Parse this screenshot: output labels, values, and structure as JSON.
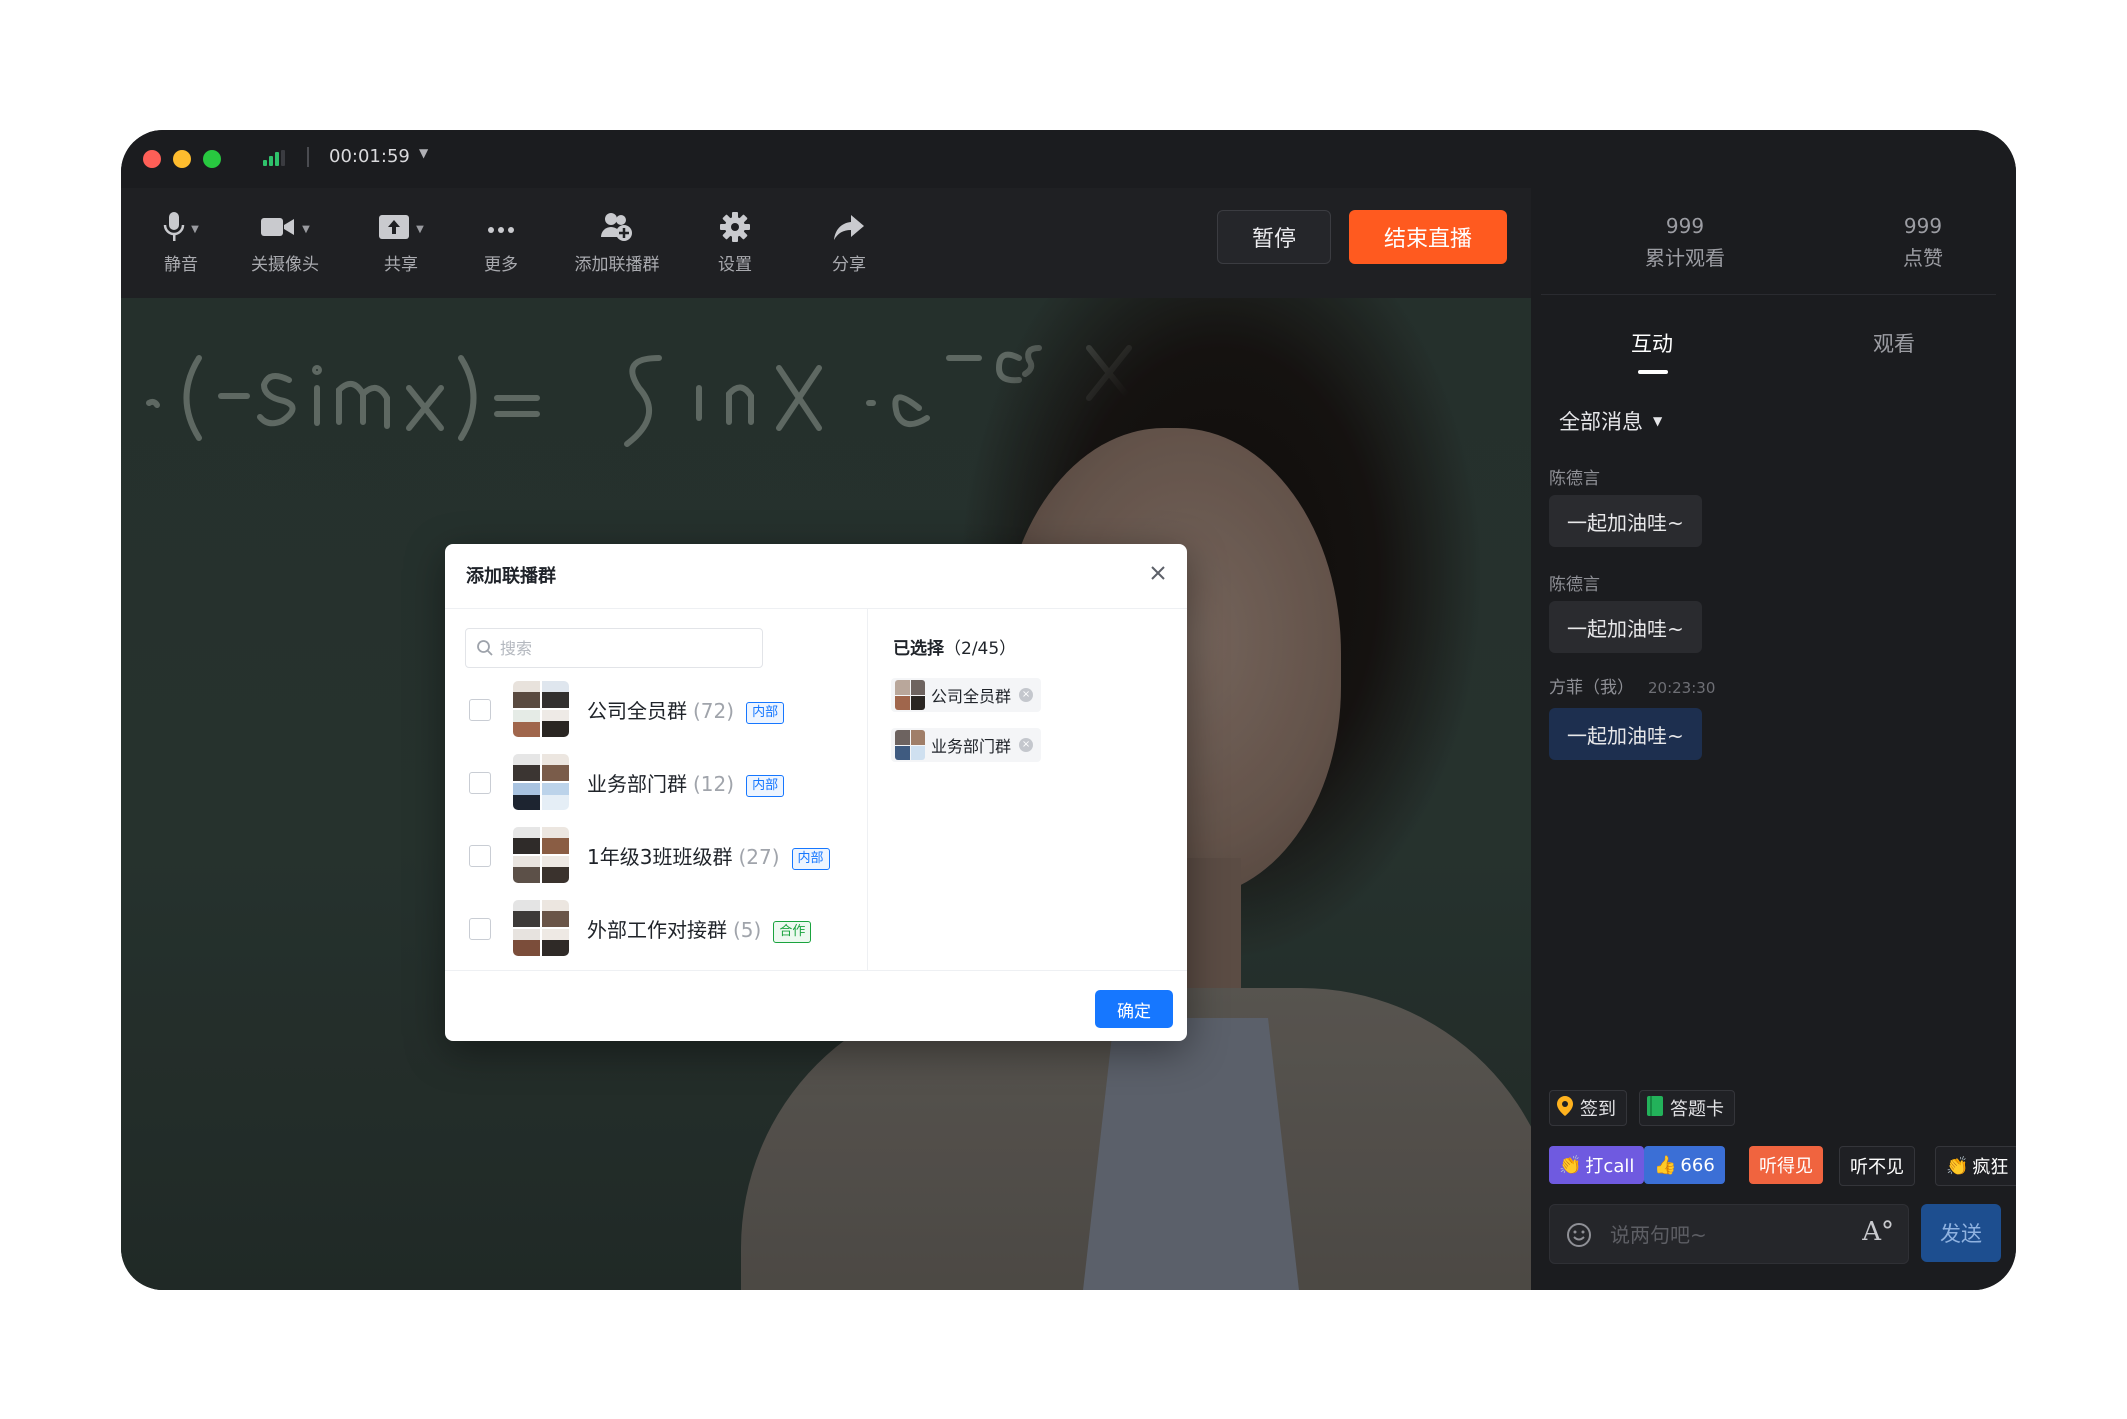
{
  "titlebar": {
    "timer": "00:01:59"
  },
  "toolbar": {
    "items": [
      {
        "label": "静音",
        "icon": "microphone-icon"
      },
      {
        "label": "关摄像头",
        "icon": "camera-icon"
      },
      {
        "label": "共享",
        "icon": "share-screen-icon"
      },
      {
        "label": "更多",
        "icon": "more-icon"
      },
      {
        "label": "添加联播群",
        "icon": "add-group-icon"
      },
      {
        "label": "设置",
        "icon": "gear-icon"
      },
      {
        "label": "分享",
        "icon": "forward-icon"
      }
    ],
    "pause_label": "暂停",
    "end_label": "结束直播"
  },
  "modal": {
    "title": "添加联播群",
    "search_placeholder": "搜索",
    "groups": [
      {
        "name": "公司全员群",
        "count": "(72)",
        "tag": "内部"
      },
      {
        "name": "业务部门群",
        "count": "(12)",
        "tag": "内部"
      },
      {
        "name": "1年级3班班级群",
        "count": "(27)",
        "tag": "内部"
      },
      {
        "name": "外部工作对接群",
        "count": "(5)",
        "tag": "合作"
      }
    ],
    "selected_title": "已选择",
    "selected_count": "（2/45）",
    "selected": [
      {
        "name": "公司全员群"
      },
      {
        "name": "业务部门群"
      }
    ],
    "ok_label": "确定"
  },
  "side": {
    "stats": [
      {
        "number": "999",
        "label": "累计观看"
      },
      {
        "number": "999",
        "label": "点赞"
      }
    ],
    "tabs": [
      {
        "label": "互动"
      },
      {
        "label": "观看"
      }
    ],
    "filter_label": "全部消息",
    "messages": [
      {
        "name": "陈德言",
        "time": "",
        "text": "一起加油哇~"
      },
      {
        "name": "陈德言",
        "time": "",
        "text": "一起加油哇~"
      },
      {
        "name": "方菲（我）",
        "time": "20:23:30",
        "text": "一起加油哇~"
      }
    ],
    "quick_actions": [
      {
        "label": "签到"
      },
      {
        "label": "答题卡"
      }
    ],
    "emotes": [
      {
        "label": "打call",
        "color": "#6f5ae0"
      },
      {
        "label": "666",
        "color": "#3b6fd6"
      },
      {
        "label": "听得见",
        "color": "#f0643f"
      },
      {
        "label": "听不见",
        "color": "#1f2024"
      },
      {
        "label": "疯狂",
        "color": "#1f2024"
      }
    ],
    "input_placeholder": "说两句吧~",
    "format_label": "A°",
    "send_label": "发送"
  },
  "colors": {
    "accent": "#1677ff",
    "end_live": "#ff5a1f",
    "internal_tag": "#1677ff",
    "partner_tag": "#1aa33e"
  }
}
